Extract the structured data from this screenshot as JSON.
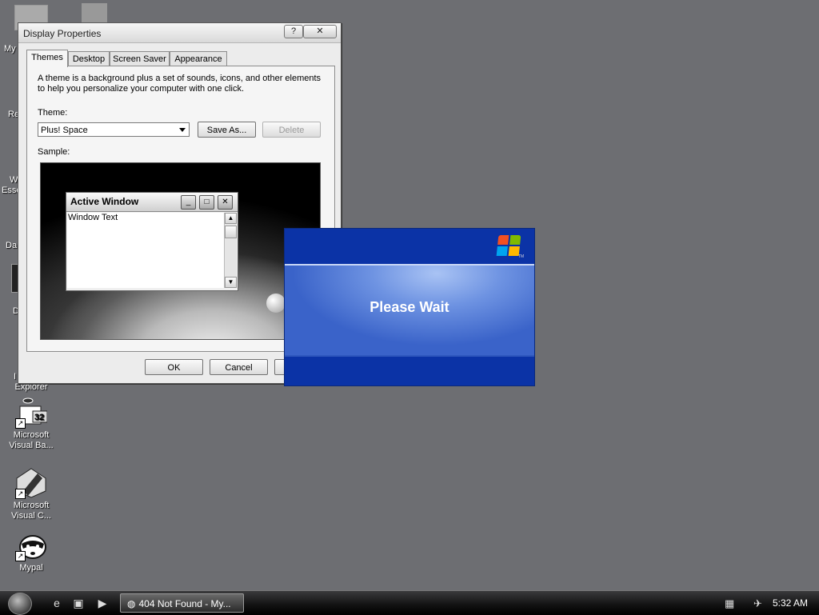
{
  "desktop": {
    "partial_labels": [
      "My",
      "Re",
      "W",
      "Esse",
      "Da",
      "D",
      "I"
    ],
    "icons": [
      {
        "label": "Explorer"
      },
      {
        "label": "Microsoft Visual Ba...",
        "badge": "32"
      },
      {
        "label": "Microsoft Visual C..."
      },
      {
        "label": "Mypal"
      }
    ]
  },
  "dialog": {
    "title": "Display Properties",
    "help_glyph": "?",
    "close_glyph": "✕",
    "tabs": [
      "Themes",
      "Desktop",
      "Screen Saver",
      "Appearance"
    ],
    "active_tab": "Themes",
    "description": "A theme is a background plus a set of sounds, icons, and other elements to help you personalize your computer with one click.",
    "theme_label": "Theme:",
    "theme_value": "Plus! Space",
    "save_as_label": "Save As...",
    "delete_label": "Delete",
    "sample_label": "Sample:",
    "preview": {
      "window_title": "Active Window",
      "window_text": "Window Text"
    },
    "ok_label": "OK",
    "cancel_label": "Cancel"
  },
  "wait_dialog": {
    "message": "Please Wait",
    "tm": "TM"
  },
  "taskbar": {
    "task_label": "404 Not Found - My...",
    "clock": "5:32 AM"
  },
  "colors": {
    "desktop": "#6d6e72",
    "wait_blue": "#0b33a6",
    "wait_band": "#6e93e2"
  }
}
